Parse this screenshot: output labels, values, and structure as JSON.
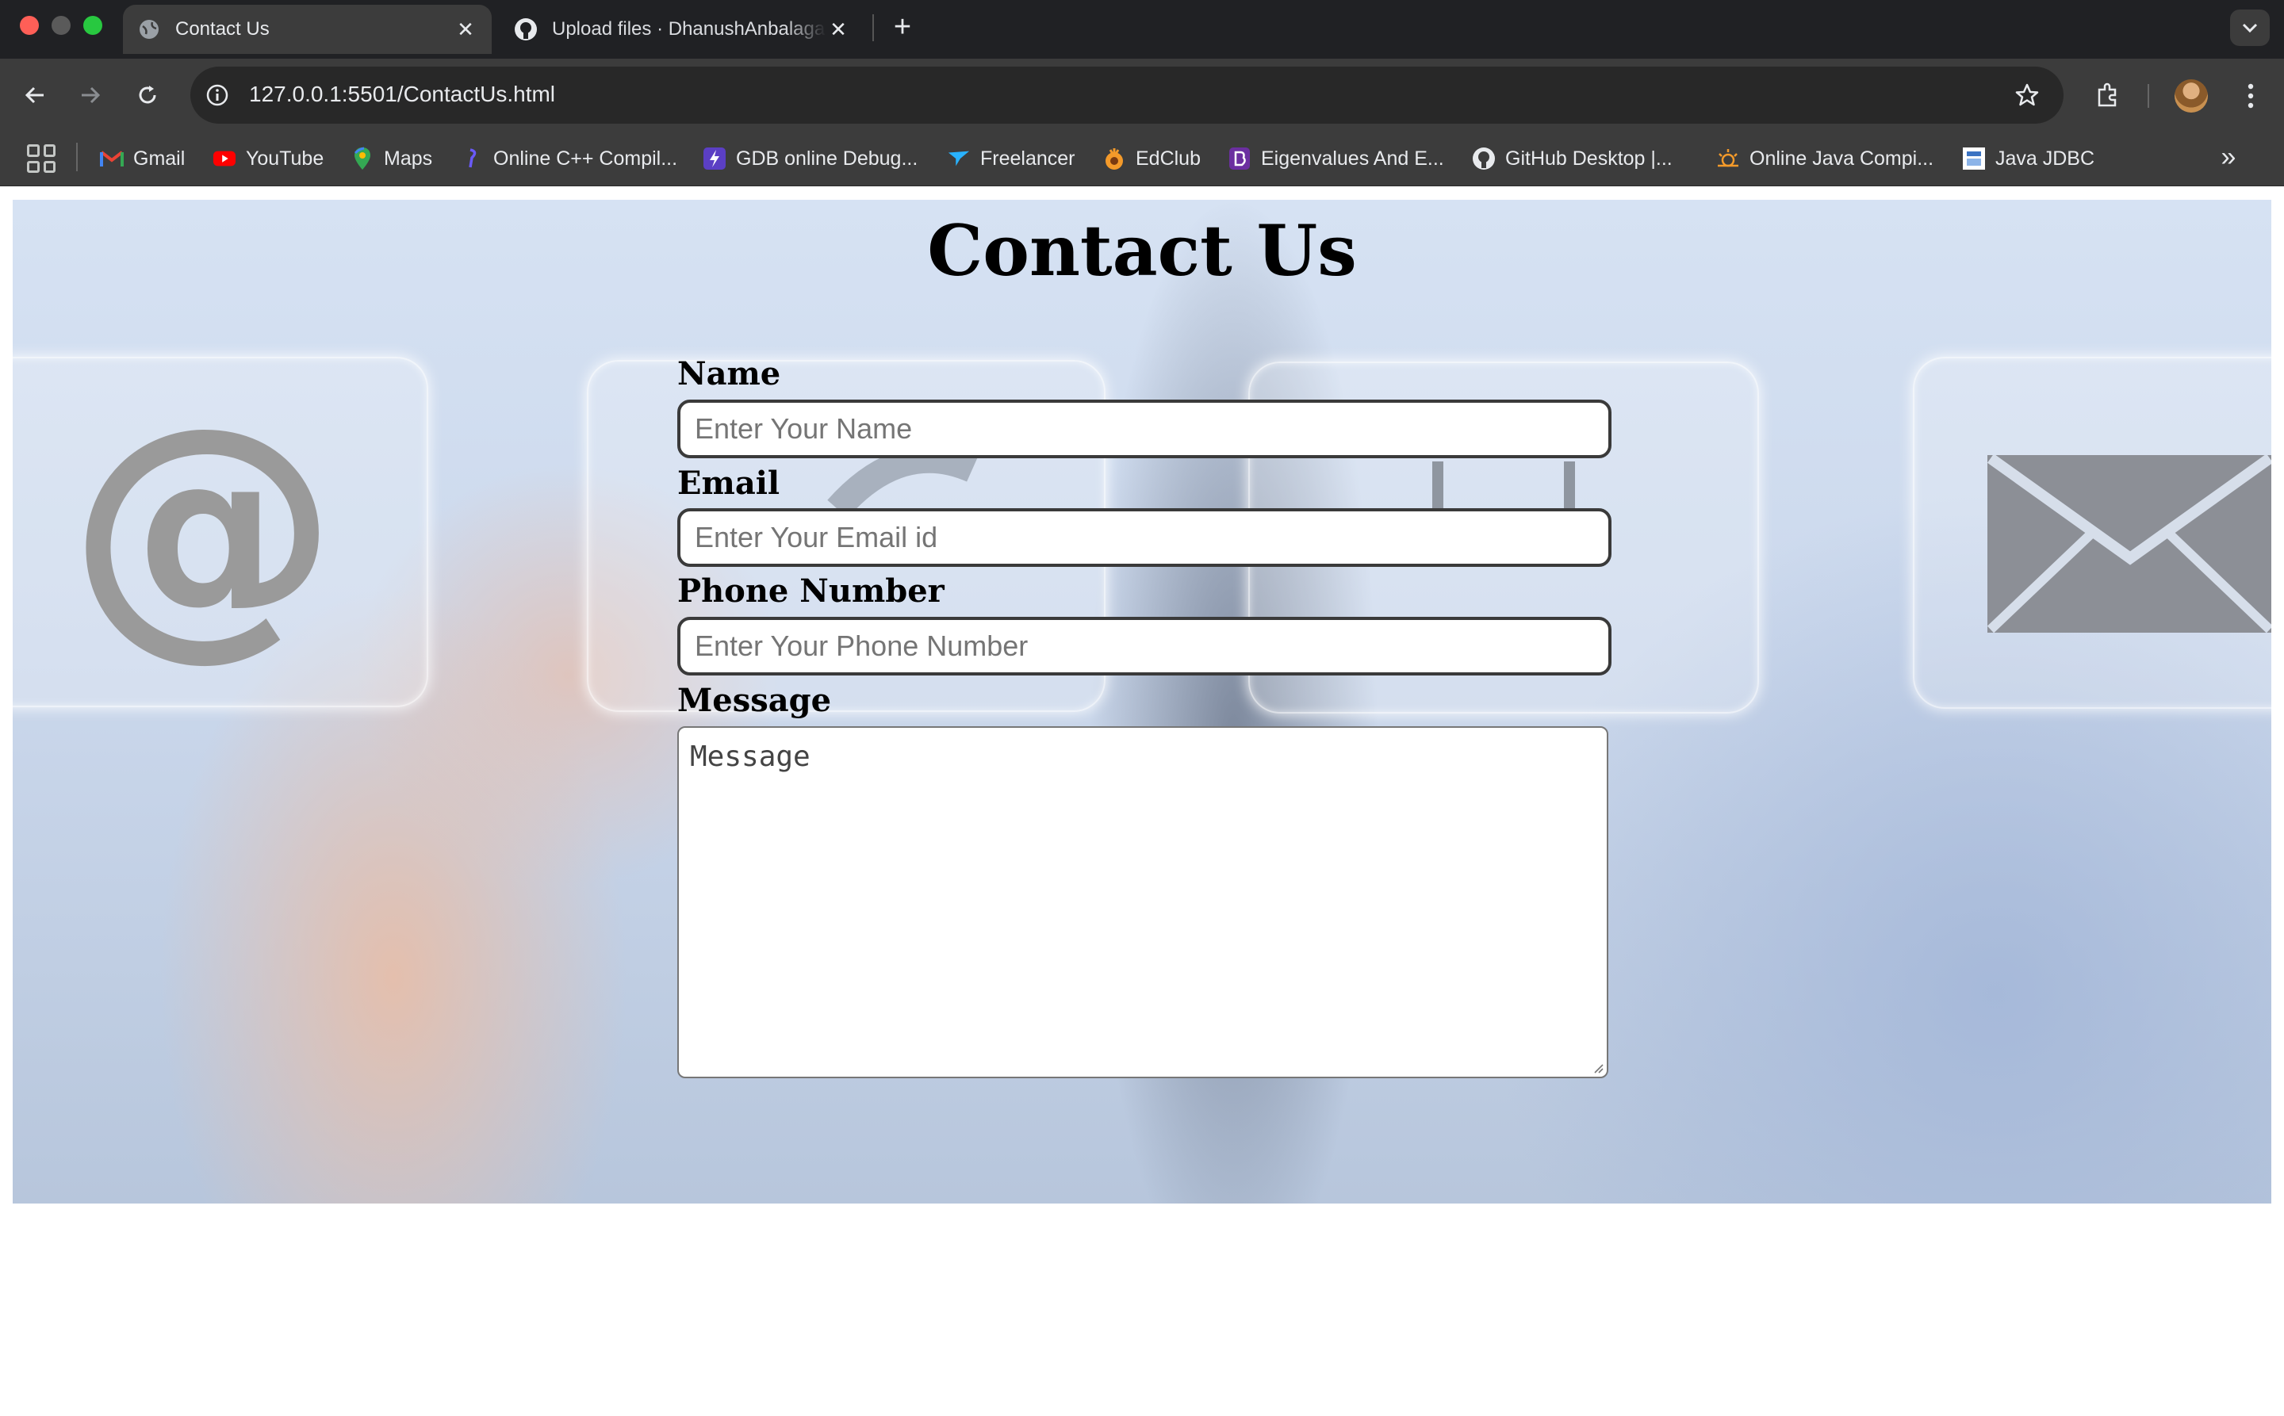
{
  "browser": {
    "tabs": [
      {
        "title": "Contact Us",
        "active": true,
        "icon": "globe-icon"
      },
      {
        "title": "Upload files · DhanushAnbalagan",
        "active": false,
        "icon": "github-icon"
      }
    ],
    "address": "127.0.0.1:5501/ContactUs.html",
    "bookmarks": [
      {
        "label": "Gmail",
        "icon": "gmail-icon"
      },
      {
        "label": "YouTube",
        "icon": "youtube-icon"
      },
      {
        "label": "Maps",
        "icon": "maps-icon"
      },
      {
        "label": "Online C++ Compil...",
        "icon": "cpp-compiler-icon"
      },
      {
        "label": "GDB online Debug...",
        "icon": "gdb-icon"
      },
      {
        "label": "Freelancer",
        "icon": "freelancer-icon"
      },
      {
        "label": "EdClub",
        "icon": "edclub-icon"
      },
      {
        "label": "Eigenvalues And E...",
        "icon": "eigenvalues-icon"
      },
      {
        "label": "GitHub Desktop |...",
        "icon": "github-icon"
      },
      {
        "label": "Online Java Compi...",
        "icon": "java-compiler-icon"
      },
      {
        "label": "Java JDBC",
        "icon": "jdbc-icon"
      }
    ],
    "colors": {
      "chrome_dark": "#202124",
      "toolbar": "#3c3c3c"
    }
  },
  "page": {
    "title": "Contact Us",
    "fields": {
      "name": {
        "label": "Name",
        "placeholder": "Enter Your Name",
        "value": ""
      },
      "email": {
        "label": "Email",
        "placeholder": "Enter Your Email id",
        "value": ""
      },
      "phone": {
        "label": "Phone Number",
        "placeholder": "Enter Your Phone Number",
        "value": ""
      },
      "message": {
        "label": "Message",
        "placeholder": "Message",
        "value": ""
      }
    },
    "background_icons": {
      "at_sign": "@"
    }
  }
}
